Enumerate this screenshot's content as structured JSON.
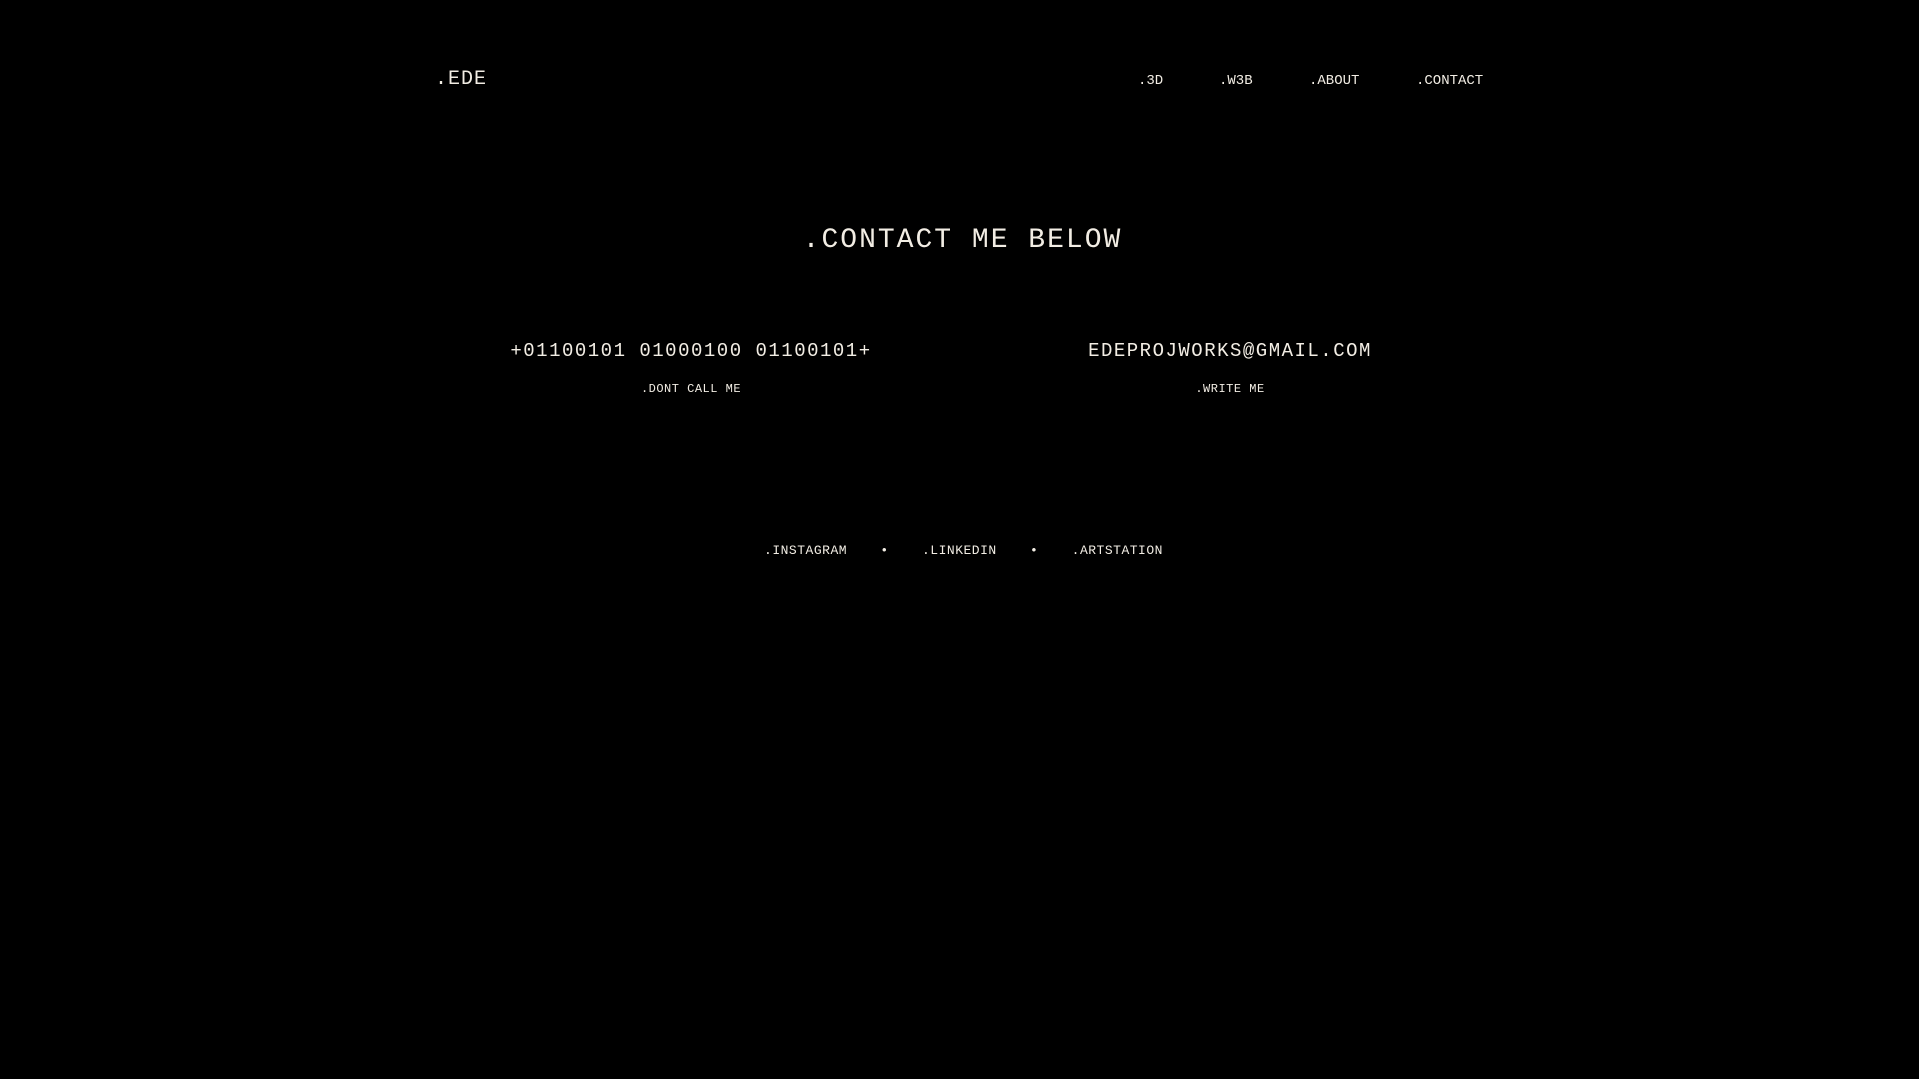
{
  "header": {
    "logo": ".EDE",
    "nav": [
      {
        "label": ".3D"
      },
      {
        "label": ".W3B"
      },
      {
        "label": ".ABOUT"
      },
      {
        "label": ".CONTACT"
      }
    ]
  },
  "main": {
    "heading": ".CONTACT ME BELOW",
    "phone": {
      "value": "+01100101 01000100 01100101+",
      "caption": ".DONT CALL ME"
    },
    "email": {
      "value": "EDEPROJWORKS@GMAIL.COM",
      "caption": ".WRITE ME"
    }
  },
  "socials": {
    "items": [
      {
        "label": ".INSTAGRAM"
      },
      {
        "label": ".LINKEDIN"
      },
      {
        "label": ".ARTSTATION"
      }
    ],
    "separator": "•"
  },
  "colors": {
    "background": "#000000",
    "text": "#f2ede4"
  }
}
